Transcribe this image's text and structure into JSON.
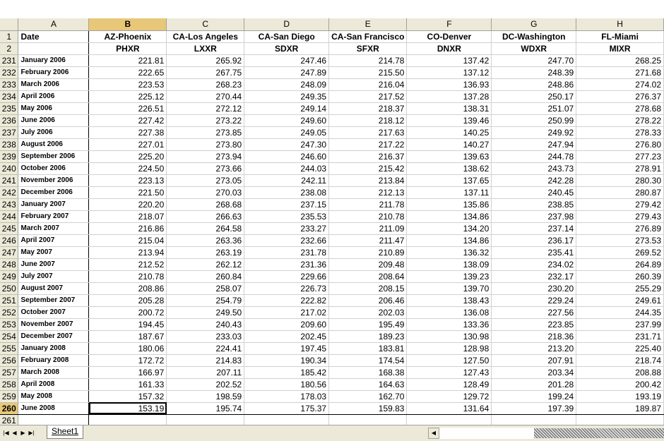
{
  "columns": [
    "A",
    "B",
    "C",
    "D",
    "E",
    "F",
    "G",
    "H"
  ],
  "selected_column": "B",
  "header_row1": {
    "row": "1",
    "cells": [
      "Date",
      "AZ-Phoenix",
      "CA-Los Angeles",
      "CA-San Diego",
      "CA-San Francisco",
      "CO-Denver",
      "DC-Washington",
      "FL-Miami"
    ]
  },
  "header_row2": {
    "row": "2",
    "cells": [
      "",
      "PHXR",
      "LXXR",
      "SDXR",
      "SFXR",
      "DNXR",
      "WDXR",
      "MIXR"
    ]
  },
  "rows": [
    {
      "row": "231",
      "date": "January 2006",
      "values": [
        "221.81",
        "265.92",
        "247.46",
        "214.78",
        "137.42",
        "247.70",
        "268.25"
      ]
    },
    {
      "row": "232",
      "date": "February 2006",
      "values": [
        "222.65",
        "267.75",
        "247.89",
        "215.50",
        "137.12",
        "248.39",
        "271.68"
      ]
    },
    {
      "row": "233",
      "date": "March 2006",
      "values": [
        "223.53",
        "268.23",
        "248.09",
        "216.04",
        "136.93",
        "248.86",
        "274.02"
      ]
    },
    {
      "row": "234",
      "date": "April 2006",
      "values": [
        "225.12",
        "270.44",
        "249.35",
        "217.52",
        "137.28",
        "250.17",
        "276.37"
      ]
    },
    {
      "row": "235",
      "date": "May 2006",
      "values": [
        "226.51",
        "272.12",
        "249.14",
        "218.37",
        "138.31",
        "251.07",
        "278.68"
      ]
    },
    {
      "row": "236",
      "date": "June 2006",
      "values": [
        "227.42",
        "273.22",
        "249.60",
        "218.12",
        "139.46",
        "250.99",
        "278.22"
      ]
    },
    {
      "row": "237",
      "date": "July 2006",
      "values": [
        "227.38",
        "273.85",
        "249.05",
        "217.63",
        "140.25",
        "249.92",
        "278.33"
      ]
    },
    {
      "row": "238",
      "date": "August 2006",
      "values": [
        "227.01",
        "273.80",
        "247.30",
        "217.22",
        "140.27",
        "247.94",
        "276.80"
      ]
    },
    {
      "row": "239",
      "date": "September 2006",
      "values": [
        "225.20",
        "273.94",
        "246.60",
        "216.37",
        "139.63",
        "244.78",
        "277.23"
      ]
    },
    {
      "row": "240",
      "date": "October 2006",
      "values": [
        "224.50",
        "273.66",
        "244.03",
        "215.42",
        "138.62",
        "243.73",
        "278.91"
      ]
    },
    {
      "row": "241",
      "date": "November 2006",
      "values": [
        "223.13",
        "273.05",
        "242.11",
        "213.84",
        "137.65",
        "242.28",
        "280.30"
      ]
    },
    {
      "row": "242",
      "date": "December 2006",
      "values": [
        "221.50",
        "270.03",
        "238.08",
        "212.13",
        "137.11",
        "240.45",
        "280.87"
      ]
    },
    {
      "row": "243",
      "date": "January 2007",
      "values": [
        "220.20",
        "268.68",
        "237.15",
        "211.78",
        "135.86",
        "238.85",
        "279.42"
      ]
    },
    {
      "row": "244",
      "date": "February 2007",
      "values": [
        "218.07",
        "266.63",
        "235.53",
        "210.78",
        "134.86",
        "237.98",
        "279.43"
      ]
    },
    {
      "row": "245",
      "date": "March 2007",
      "values": [
        "216.86",
        "264.58",
        "233.27",
        "211.09",
        "134.20",
        "237.14",
        "276.89"
      ]
    },
    {
      "row": "246",
      "date": "April 2007",
      "values": [
        "215.04",
        "263.36",
        "232.66",
        "211.47",
        "134.86",
        "236.17",
        "273.53"
      ]
    },
    {
      "row": "247",
      "date": "May 2007",
      "values": [
        "213.94",
        "263.19",
        "231.78",
        "210.89",
        "136.32",
        "235.41",
        "269.52"
      ]
    },
    {
      "row": "248",
      "date": "June 2007",
      "values": [
        "212.52",
        "262.12",
        "231.36",
        "209.48",
        "138.09",
        "234.02",
        "264.89"
      ]
    },
    {
      "row": "249",
      "date": "July 2007",
      "values": [
        "210.78",
        "260.84",
        "229.66",
        "208.64",
        "139.23",
        "232.17",
        "260.39"
      ]
    },
    {
      "row": "250",
      "date": "August 2007",
      "values": [
        "208.86",
        "258.07",
        "226.73",
        "208.15",
        "139.70",
        "230.20",
        "255.29"
      ]
    },
    {
      "row": "251",
      "date": "September 2007",
      "values": [
        "205.28",
        "254.79",
        "222.82",
        "206.46",
        "138.43",
        "229.24",
        "249.61"
      ]
    },
    {
      "row": "252",
      "date": "October 2007",
      "values": [
        "200.72",
        "249.50",
        "217.02",
        "202.03",
        "136.08",
        "227.56",
        "244.35"
      ]
    },
    {
      "row": "253",
      "date": "November 2007",
      "values": [
        "194.45",
        "240.43",
        "209.60",
        "195.49",
        "133.36",
        "223.85",
        "237.99"
      ]
    },
    {
      "row": "254",
      "date": "December 2007",
      "values": [
        "187.67",
        "233.03",
        "202.45",
        "189.23",
        "130.98",
        "218.36",
        "231.71"
      ]
    },
    {
      "row": "255",
      "date": "January 2008",
      "values": [
        "180.06",
        "224.41",
        "197.45",
        "183.81",
        "128.98",
        "213.20",
        "225.40"
      ]
    },
    {
      "row": "256",
      "date": "February 2008",
      "values": [
        "172.72",
        "214.83",
        "190.34",
        "174.54",
        "127.50",
        "207.91",
        "218.74"
      ]
    },
    {
      "row": "257",
      "date": "March 2008",
      "values": [
        "166.97",
        "207.11",
        "185.42",
        "168.38",
        "127.43",
        "203.34",
        "208.88"
      ]
    },
    {
      "row": "258",
      "date": "April 2008",
      "values": [
        "161.33",
        "202.52",
        "180.56",
        "164.63",
        "128.49",
        "201.28",
        "200.42"
      ]
    },
    {
      "row": "259",
      "date": "May 2008",
      "values": [
        "157.32",
        "198.59",
        "178.03",
        "162.70",
        "129.72",
        "199.24",
        "193.19"
      ]
    },
    {
      "row": "260",
      "date": "June 2008",
      "values": [
        "153.19",
        "195.74",
        "175.37",
        "159.83",
        "131.64",
        "197.39",
        "189.87"
      ]
    }
  ],
  "empty_row": "261",
  "active_cell": {
    "row": "260",
    "col": "B"
  },
  "sheet_tab": "Sheet1",
  "nav_buttons": [
    {
      "name": "first-sheet-button",
      "glyph": "|◀"
    },
    {
      "name": "prev-sheet-button",
      "glyph": "◀"
    },
    {
      "name": "next-sheet-button",
      "glyph": "▶"
    },
    {
      "name": "last-sheet-button",
      "glyph": "▶|"
    }
  ],
  "scroll_left_glyph": "◀",
  "colors": {
    "header_bg": "#ece9d8",
    "selected_header_bg": "#e8c878",
    "grid": "#d0d0d0"
  }
}
